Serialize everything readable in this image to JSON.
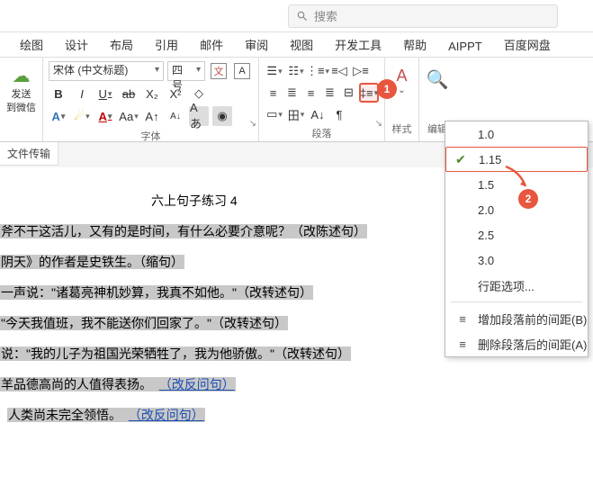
{
  "search": {
    "placeholder": "搜索"
  },
  "tabs": [
    "绘图",
    "设计",
    "布局",
    "引用",
    "邮件",
    "审阅",
    "视图",
    "开发工具",
    "帮助",
    "AIPPT",
    "百度网盘"
  ],
  "send": {
    "line1": "发送",
    "line2": "到微信"
  },
  "file_transfer_label": "文件传输",
  "font": {
    "name": "宋体 (中文标题)",
    "size": "四号",
    "group_label": "字体",
    "wen": "文",
    "A_box": "A",
    "bold": "B",
    "italic": "I",
    "underline": "U",
    "strike": "ab",
    "sub": "X₂",
    "sup": "X²",
    "clear": "◇",
    "row3a": "A",
    "row3b": "☄",
    "row3c": "A",
    "row3d": "Aa",
    "row3e": "A↑",
    "row3f": "A↓",
    "row3g": "Aあ",
    "row3h": "◉"
  },
  "paragraph": {
    "group_label": "段落",
    "linespacing_tooltip": "行距"
  },
  "styles_label": "样式",
  "edit_label": "编辑",
  "linespacing": {
    "options": [
      "1.0",
      "1.15",
      "1.5",
      "2.0",
      "2.5",
      "3.0"
    ],
    "more": "行距选项...",
    "add_before": "增加段落前的间距(B)",
    "remove_after": "删除段落后的间距(A)"
  },
  "markers": {
    "one": "1",
    "two": "2"
  },
  "document": {
    "title": "六上句子练习 4",
    "lines": [
      "斧不干这活儿，又有的是时间，有什么必要介意呢？（改陈述句）",
      "阴天》的作者是史铁生。（缩句）",
      "一声说：\"诸葛亮神机妙算，我真不如他。\"（改转述句）",
      "\"今天我值班，我不能送你们回家了。\"（改转述句）",
      "说：\"我的儿子为祖国光荣牺牲了，我为他骄傲。\"（改转述句）",
      "羊品德高尚的人值得表扬。",
      "人类尚未完全领悟。"
    ],
    "link_text": "（改反问句）"
  }
}
